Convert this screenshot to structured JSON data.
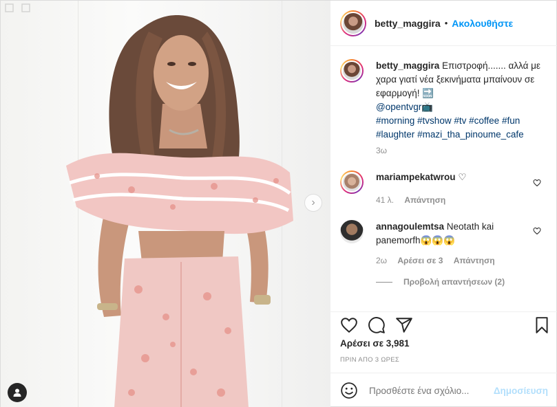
{
  "post": {
    "username": "betty_maggira",
    "follow_label": "Ακολουθήστε",
    "separator": "•"
  },
  "caption": {
    "username": "betty_maggira",
    "text": "Επιστροφή....... αλλά με χαρα γιατί νέα ξεκινήματα μπαίνουν σε εφαρμογή! 🔜",
    "mention": "@opentvgr",
    "mention_suffix": "📺",
    "hashtags_line1": [
      "#morning",
      "#tvshow",
      "#tv",
      "#coffee",
      "#fun"
    ],
    "hashtags_line2": [
      "#laughter",
      "#mazi_tha_pinoume_cafe"
    ],
    "age": "3ω"
  },
  "comments": [
    {
      "username": "mariampekatwrou",
      "text": "♡",
      "age": "41 λ.",
      "reply_label": "Απάντηση"
    },
    {
      "username": "annagoulemtsa",
      "text": "Neotath kai panemorfh😱😱😱",
      "age": "2ω",
      "likes_label": "Αρέσει σε 3",
      "reply_label": "Απάντηση"
    }
  ],
  "view_replies_label": "Προβολή απαντήσεων (2)",
  "likes_text": "Αρέσει σε 3,981",
  "posted_when": "ΠΡΙΝ ΑΠΟ 3 ΩΡΕΣ",
  "add_comment": {
    "placeholder": "Προσθέστε ένα σχόλιο...",
    "post_label": "Δημοσίευση"
  },
  "colors": {
    "link_blue": "#0095f6",
    "hashtag_blue": "#00376b",
    "muted": "#8e8e8e",
    "post_disabled": "#b2dffc"
  },
  "icons": [
    "heart-icon",
    "comment-icon",
    "share-icon",
    "bookmark-icon",
    "emoji-icon",
    "chevron-right-icon",
    "user-tag-icon",
    "multi-image-icon"
  ]
}
